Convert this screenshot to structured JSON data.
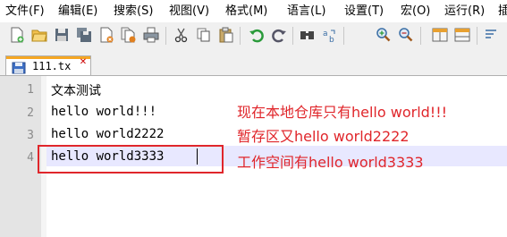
{
  "menu": {
    "items": [
      "文件(F)",
      "编辑(E)",
      "搜索(S)",
      "视图(V)",
      "格式(M)",
      "语言(L)",
      "设置(T)",
      "宏(O)",
      "运行(R)",
      "插"
    ]
  },
  "toolbar": {
    "icons": [
      "new-file-icon",
      "open-file-icon",
      "save-icon",
      "save-all-icon",
      "close-icon",
      "close-all-icon",
      "print-icon",
      "cut-icon",
      "copy-icon",
      "paste-icon",
      "undo-icon",
      "redo-icon",
      "find-icon",
      "replace-icon",
      "zoom-in-icon",
      "zoom-out-icon",
      "sync-vertical-icon",
      "sync-horizontal-icon",
      "word-wrap-icon"
    ]
  },
  "tab": {
    "label": "111.tx",
    "close_symbol": "✕"
  },
  "editor": {
    "lines": [
      {
        "number": "1",
        "text": "文本测试"
      },
      {
        "number": "2",
        "text": "hello world!!!"
      },
      {
        "number": "3",
        "text": "hello world2222"
      },
      {
        "number": "4",
        "text": "hello world3333"
      }
    ]
  },
  "annotations": {
    "note1": "现在本地仓库只有hello world!!!",
    "note2": "暂存区又hello world2222",
    "note3": "工作空间有hello world3333"
  },
  "colors": {
    "annotation": "#e0262b",
    "current_line": "#e8e8ff",
    "gutter": "#e4e4e4",
    "tab_accent": "#f5a623"
  }
}
